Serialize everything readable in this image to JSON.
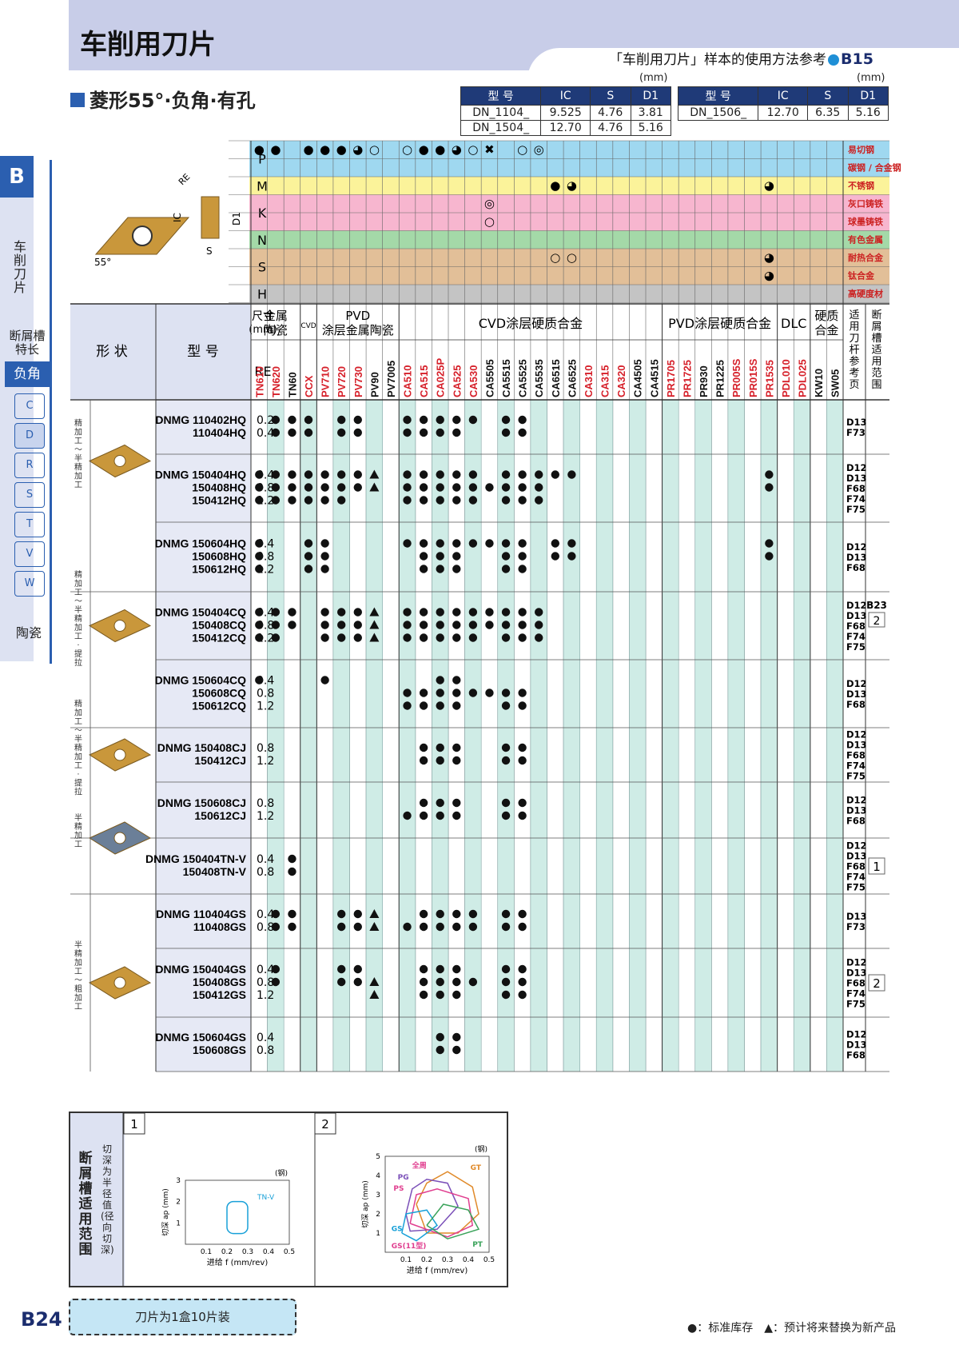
{
  "header": {
    "title": "车削用刀片",
    "reference": "「车削用刀片」样本的使用方法参考",
    "reference_page": "B15"
  },
  "subhead": "菱形55°·负角·有孔",
  "dims": {
    "unit": "(mm)",
    "left": {
      "headers": [
        "型 号",
        "IC",
        "S",
        "D1"
      ],
      "rows": [
        [
          "DN_1104_",
          "9.525",
          "4.76",
          "3.81"
        ],
        [
          "DN_1504_",
          "12.70",
          "4.76",
          "5.16"
        ]
      ]
    },
    "right": {
      "headers": [
        "型 号",
        "IC",
        "S",
        "D1"
      ],
      "rows": [
        [
          "DN_1506_",
          "12.70",
          "6.35",
          "5.16"
        ]
      ]
    }
  },
  "sidebar": {
    "letter": "B",
    "section": "车削刀片",
    "chip_label": "断屑槽特长",
    "active": "负角",
    "shapes": [
      "C",
      "D",
      "R",
      "S",
      "T",
      "V",
      "W"
    ],
    "ceramic": "陶瓷"
  },
  "materials": [
    {
      "code": "P",
      "label": "易切钢",
      "color": "#9fd8f0"
    },
    {
      "code": "",
      "label": "碳钢 / 合金钢",
      "color": "#9fd8f0"
    },
    {
      "code": "M",
      "label": "不锈钢",
      "color": "#fbf39a"
    },
    {
      "code": "K",
      "label": "灰口铸铁",
      "color": "#f7b6cf"
    },
    {
      "code": "",
      "label": "球墨铸铁",
      "color": "#f7b6cf"
    },
    {
      "code": "N",
      "label": "有色金属",
      "color": "#a4d9a8"
    },
    {
      "code": "S",
      "label": "耐热合金",
      "color": "#e2bf98"
    },
    {
      "code": "",
      "label": "钛合金",
      "color": "#e2bf98"
    },
    {
      "code": "H",
      "label": "高硬度材",
      "color": "#c4c4c4"
    }
  ],
  "table": {
    "shape_hdr": "形 状",
    "model_hdr": "型 号",
    "size_hdr": "尺寸(mm)",
    "re_hdr": "RE",
    "groups": [
      "金属陶瓷",
      "CVD",
      "PVD涂层金属陶瓷",
      "CVD涂层硬质合金",
      "PVD涂层硬质合金",
      "DLC",
      "硬质合金"
    ],
    "ref_hdr": "适用刀杆参考页",
    "chip_hdr": "断屑槽适用范围",
    "grades": [
      {
        "n": "TN610",
        "c": "#d6202a"
      },
      {
        "n": "TN620",
        "c": "#d6202a"
      },
      {
        "n": "TN60",
        "c": "#111"
      },
      {
        "n": "CCX",
        "c": "#d6202a"
      },
      {
        "n": "PV710",
        "c": "#d6202a"
      },
      {
        "n": "PV720",
        "c": "#d6202a"
      },
      {
        "n": "PV730",
        "c": "#d6202a"
      },
      {
        "n": "PV90",
        "c": "#111"
      },
      {
        "n": "PV7005",
        "c": "#111"
      },
      {
        "n": "CA510",
        "c": "#d6202a"
      },
      {
        "n": "CA515",
        "c": "#d6202a"
      },
      {
        "n": "CA025P",
        "c": "#d6202a"
      },
      {
        "n": "CA525",
        "c": "#d6202a"
      },
      {
        "n": "CA530",
        "c": "#d6202a"
      },
      {
        "n": "CA5505",
        "c": "#111"
      },
      {
        "n": "CA5515",
        "c": "#111"
      },
      {
        "n": "CA5525",
        "c": "#111"
      },
      {
        "n": "CA5535",
        "c": "#111"
      },
      {
        "n": "CA6515",
        "c": "#111"
      },
      {
        "n": "CA6525",
        "c": "#111"
      },
      {
        "n": "CA310",
        "c": "#d6202a"
      },
      {
        "n": "CA315",
        "c": "#d6202a"
      },
      {
        "n": "CA320",
        "c": "#d6202a"
      },
      {
        "n": "CA4505",
        "c": "#111"
      },
      {
        "n": "CA4515",
        "c": "#111"
      },
      {
        "n": "PR1705",
        "c": "#d6202a"
      },
      {
        "n": "PR1725",
        "c": "#d6202a"
      },
      {
        "n": "PR930",
        "c": "#111"
      },
      {
        "n": "PR1225",
        "c": "#111"
      },
      {
        "n": "PR005S",
        "c": "#d6202a"
      },
      {
        "n": "PR015S",
        "c": "#d6202a"
      },
      {
        "n": "PR1535",
        "c": "#d6202a"
      },
      {
        "n": "PDL010",
        "c": "#d6202a"
      },
      {
        "n": "PDL025",
        "c": "#d6202a"
      },
      {
        "n": "KW10",
        "c": "#111"
      },
      {
        "n": "SW05",
        "c": "#111"
      }
    ],
    "rows": [
      {
        "sec": "精加工～半精加工",
        "models": [
          "DNMG 110402HQ",
          "110404HQ"
        ],
        "re": [
          "0.2",
          "0.4"
        ],
        "ref": [
          "D13",
          "F73"
        ],
        "chip": ""
      },
      {
        "sec": "",
        "models": [
          "DNMG 150404HQ",
          "150408HQ",
          "150412HQ"
        ],
        "re": [
          "0.4",
          "0.8",
          "1.2"
        ],
        "ref": [
          "D12",
          "D13",
          "F68",
          "F74",
          "F75"
        ],
        "chip": ""
      },
      {
        "sec": "",
        "models": [
          "DNMG 150604HQ",
          "150608HQ",
          "150612HQ"
        ],
        "re": [
          "0.4",
          "0.8",
          "1.2"
        ],
        "ref": [
          "D12",
          "D13",
          "F68"
        ],
        "chip": ""
      },
      {
        "sec": "精加工～半精加工·提拉",
        "models": [
          "DNMG 150404CQ",
          "150408CQ",
          "150412CQ"
        ],
        "re": [
          "0.4",
          "0.8",
          "1.2"
        ],
        "ref": [
          "D12",
          "D13",
          "F68",
          "F74",
          "F75"
        ],
        "chip": "B23|2"
      },
      {
        "sec": "",
        "models": [
          "DNMG 150604CQ",
          "150608CQ",
          "150612CQ"
        ],
        "re": [
          "0.4",
          "0.8",
          "1.2"
        ],
        "ref": [
          "D12",
          "D13",
          "F68"
        ],
        "chip": ""
      },
      {
        "sec": "精加工～半精加工·提拉",
        "models": [
          "DNMG 150408CJ",
          "150412CJ"
        ],
        "re": [
          "0.8",
          "1.2"
        ],
        "ref": [
          "D12",
          "D13",
          "F68",
          "F74",
          "F75"
        ],
        "chip": ""
      },
      {
        "sec": "",
        "models": [
          "DNMG 150608CJ",
          "150612CJ"
        ],
        "re": [
          "0.8",
          "1.2"
        ],
        "ref": [
          "D12",
          "D13",
          "F68"
        ],
        "chip": ""
      },
      {
        "sec": "半精加工",
        "models": [
          "DNMG 150404TN-V",
          "150408TN-V"
        ],
        "re": [
          "0.4",
          "0.8"
        ],
        "ref": [
          "D12",
          "D13",
          "F68",
          "F74",
          "F75"
        ],
        "chip": "1"
      },
      {
        "sec": "半精加工～粗加工",
        "models": [
          "DNMG 110404GS",
          "110408GS"
        ],
        "re": [
          "0.4",
          "0.8"
        ],
        "ref": [
          "D13",
          "F73"
        ],
        "chip": ""
      },
      {
        "sec": "",
        "models": [
          "DNMG 150404GS",
          "150408GS",
          "150412GS"
        ],
        "re": [
          "0.4",
          "0.8",
          "1.2"
        ],
        "ref": [
          "D12",
          "D13",
          "F68",
          "F74",
          "F75"
        ],
        "chip": "2"
      },
      {
        "sec": "",
        "models": [
          "DNMG 150604GS",
          "150608GS"
        ],
        "re": [
          "0.4",
          "0.8"
        ],
        "ref": [
          "D12",
          "D13",
          "F68"
        ],
        "chip": ""
      }
    ]
  },
  "chipbreaker": {
    "title": "断屑槽适用范围",
    "subtitle": "切深为半径值(径向切深)",
    "chart1": {
      "num": "1",
      "unit": "(钢)",
      "xlabel": "进给 f (mm/rev)",
      "ylabel": "切深 ap (mm)",
      "xticks": [
        "0.1",
        "0.2",
        "0.3",
        "0.4",
        "0.5"
      ],
      "yticks": [
        "1",
        "2",
        "3"
      ],
      "label": "TN-V"
    },
    "chart2": {
      "num": "2",
      "unit": "(钢)",
      "xlabel": "进给 f (mm/rev)",
      "ylabel": "切深 ap (mm)",
      "xticks": [
        "0.1",
        "0.2",
        "0.3",
        "0.4",
        "0.5"
      ],
      "yticks": [
        "1",
        "2",
        "3",
        "4",
        "5"
      ],
      "labels": [
        "全周",
        "GT",
        "PG",
        "PS",
        "GS",
        "GS(11型)",
        "PT"
      ]
    }
  },
  "footer": {
    "page": "B24",
    "pack": "刀片为1盒10片装",
    "legend": "●：标准库存　▲：预计将来替换为新产品"
  }
}
